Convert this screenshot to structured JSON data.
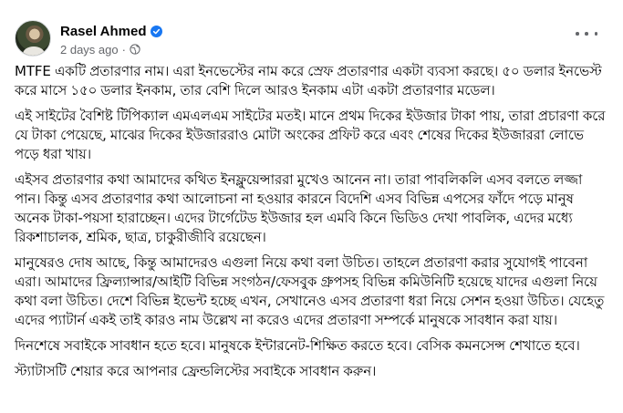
{
  "post": {
    "author": "Rasel Ahmed",
    "verified": true,
    "timestamp": "2 days ago",
    "separator": "·",
    "audience_icon": "globe-icon",
    "more_icon": "more-options-icon",
    "paragraphs": [
      "MTFE একটি প্রতারণার নাম। এরা ইনভেস্টের নাম করে স্রেফ প্রতারণার একটা ব্যবসা করছে। ৫০ ডলার ইনভেস্ট করে মাসে ১৫০ ডলার ইনকাম, তার বেশি দিলে আরও ইনকাম এটা একটা প্রতারণার মডেল।",
      "এই সাইটের বৈশিষ্ট টিপিক্যাল এমএলএম সাইটের মতই। মানে প্রথম দিকের ইউজার টাকা পায়, তারা প্রচারণা করে যে টাকা পেয়েছে, মাঝের দিকের ইউজাররাও মোটা অংকের প্রফিট করে এবং শেষের দিকের ইউজাররা লোভে পড়ে ধরা খায়।",
      "এইসব প্রতারণার কথা আমাদের কথিত ইনফ্লুয়েন্সাররা মুখেও আনেন না। তারা পাবলিকলি এসব বলতে লজ্জা পান। কিন্তু এসব প্রতারণার কথা আলোচনা না হওয়ার কারনে বিদেশি এসব বিভিন্ন এপসের ফাঁদে পড়ে মানুষ অনেক টাকা-পয়সা হারাচ্ছেন। এদের টার্গেটেড ইউজার হল এমবি কিনে ভিডিও দেখা পাবলিক, এদের মধ্যে রিকশাচালক, শ্রমিক, ছাত্র, চাকুরীজীবি রয়েছেন।",
      "মানুষেরও দোষ আছে, কিন্তু আমাদেরও এগুলা নিয়ে কথা বলা উচিত। তাহলে প্রতারণা করার সুযোগই পাবেনা এরা। আমাদের ফ্রিল্যান্সার/আইটি বিভিন্ন সংগঠন/ফেসবুক গ্রুপসহ বিভিন্ন কমিউনিটি হয়েছে যাদের এগুলা নিয়ে কথা বলা উচিত। দেশে বিভিন্ন ইভেন্ট হচ্ছে এখন, সেখানেও এসব প্রতারণা ধরা নিয়ে সেশন হওয়া উচিত। যেহেতু এদের প্যাটার্ন একই তাই কারও নাম উল্লেখ না করেও এদের প্রতারণা সম্পর্কে মানুষকে সাবধান করা যায়।",
      "দিনশেষে সবাইকে সাবধান হতে হবে। মানুষকে ইন্টারনেট-শিক্ষিত করতে হবে। বেসিক কমনসেন্স শেখাতে হবে।",
      "স্ট্যাটাসটি শেয়ার করে আপনার ফ্রেন্ডলিস্টের সবাইকে সাবধান করুন।"
    ]
  },
  "colors": {
    "verified_badge": "#1877f2",
    "secondary_text": "#65676b",
    "primary_text": "#050505"
  }
}
